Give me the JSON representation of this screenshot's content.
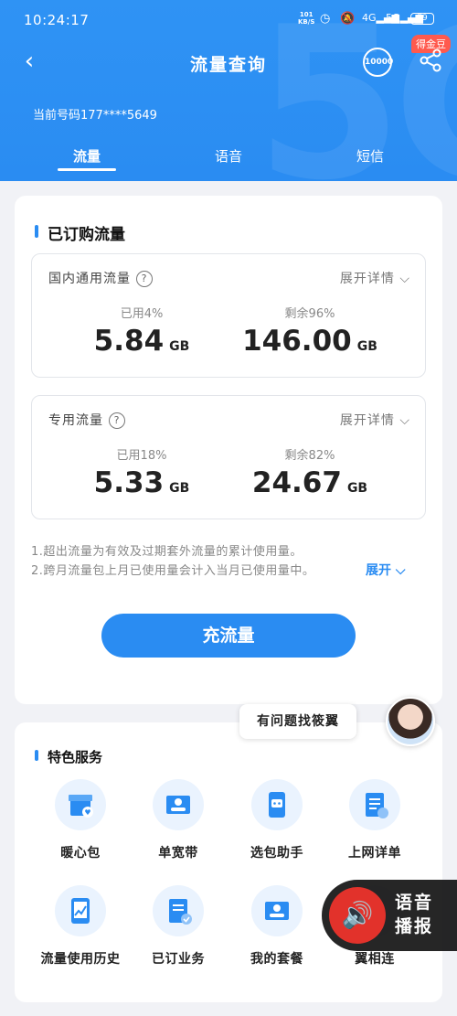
{
  "status_bar": {
    "time": "10:24:17",
    "net_speed": "101",
    "net_unit": "KB/S",
    "battery": "79"
  },
  "topbar": {
    "title": "流量查询",
    "coin_badge": "得金豆",
    "service_icon_text": "10000"
  },
  "account": {
    "phone_label": "当前号码177****5649"
  },
  "tabs": [
    {
      "label": "流量"
    },
    {
      "label": "语音"
    },
    {
      "label": "短信"
    }
  ],
  "subscribed": {
    "title": "已订购流量",
    "domestic": {
      "title": "国内通用流量",
      "expand": "展开详情",
      "used_label": "已用4%",
      "used_value": "5.84",
      "used_unit": "GB",
      "remain_label": "剩余96%",
      "remain_value": "146.00",
      "remain_unit": "GB",
      "used_percent": 4
    },
    "dedicated": {
      "title": "专用流量",
      "expand": "展开详情",
      "used_label": "已用18%",
      "used_value": "5.33",
      "used_unit": "GB",
      "remain_label": "剩余82%",
      "remain_value": "24.67",
      "remain_unit": "GB",
      "used_percent": 18
    },
    "note1": "1.超出流量为有效及过期套外流量的累计使用量。",
    "note2": "2.跨月流量包上月已使用量会计入当月已使用量中。",
    "more": "展开",
    "recharge_button": "充流量"
  },
  "helper_tip": "有问题找筱翼",
  "features": {
    "title": "特色服务",
    "items": [
      {
        "label": "暖心包",
        "icon": "gift-icon"
      },
      {
        "label": "单宽带",
        "icon": "broadband-card-icon"
      },
      {
        "label": "选包助手",
        "icon": "robot-phone-icon"
      },
      {
        "label": "上网详单",
        "icon": "clipboard-icon"
      },
      {
        "label": "流量使用历史",
        "icon": "chart-phone-icon"
      },
      {
        "label": "已订业务",
        "icon": "document-check-icon"
      },
      {
        "label": "我的套餐",
        "icon": "id-card-icon"
      },
      {
        "label": "翼相连",
        "icon": "link-icon"
      }
    ]
  },
  "voice_broadcast": {
    "line1": "语音",
    "line2": "播报"
  },
  "colors": {
    "primary": "#2a8cf2",
    "badge": "#ff5a4e",
    "voice_red": "#e2322b"
  }
}
